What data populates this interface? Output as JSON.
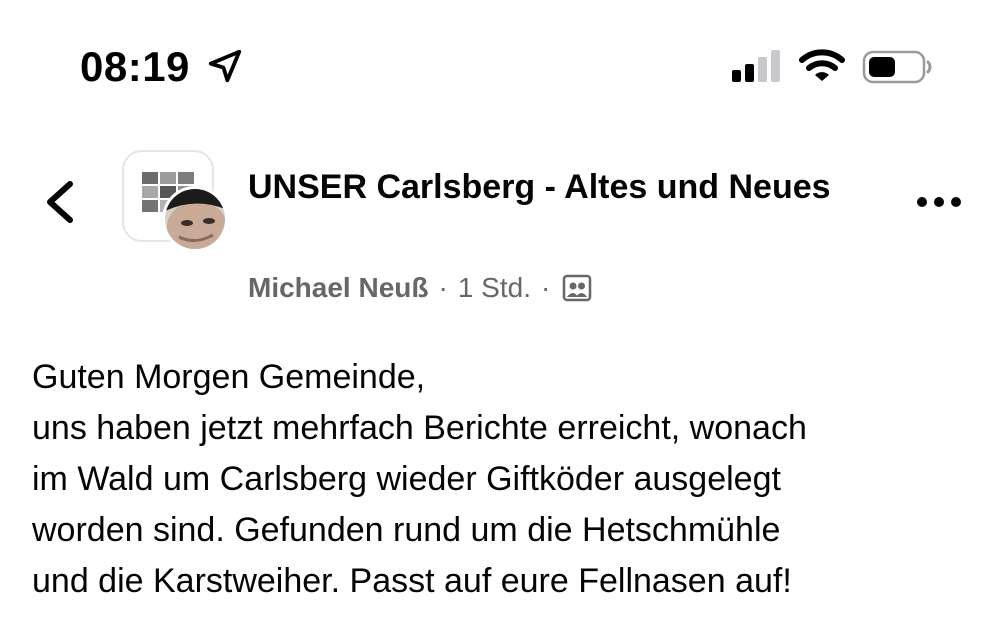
{
  "status_bar": {
    "time": "08:19",
    "location_icon": "location-arrow-icon",
    "signal_icon": "cellular-signal-icon",
    "wifi_icon": "wifi-icon",
    "battery_icon": "battery-icon"
  },
  "header": {
    "back_icon": "chevron-left-icon",
    "group_name": "UNSER Carlsberg - Altes und Neues",
    "author": "Michael Neuß",
    "separator": "·",
    "time_ago": "1 Std.",
    "audience_icon": "group-audience-icon",
    "more_icon": "more-options-icon"
  },
  "post": {
    "lines": [
      "Guten Morgen Gemeinde,",
      "uns haben jetzt mehrfach Berichte erreicht, wonach",
      "im Wald um Carlsberg wieder Giftköder ausgelegt",
      "worden sind. Gefunden rund um die Hetschmühle",
      "und die Karstweiher. Passt auf eure Fellnasen auf!"
    ]
  },
  "colors": {
    "text": "#050505",
    "secondary_text": "#65676b",
    "avatar_border": "#e4e6eb"
  }
}
